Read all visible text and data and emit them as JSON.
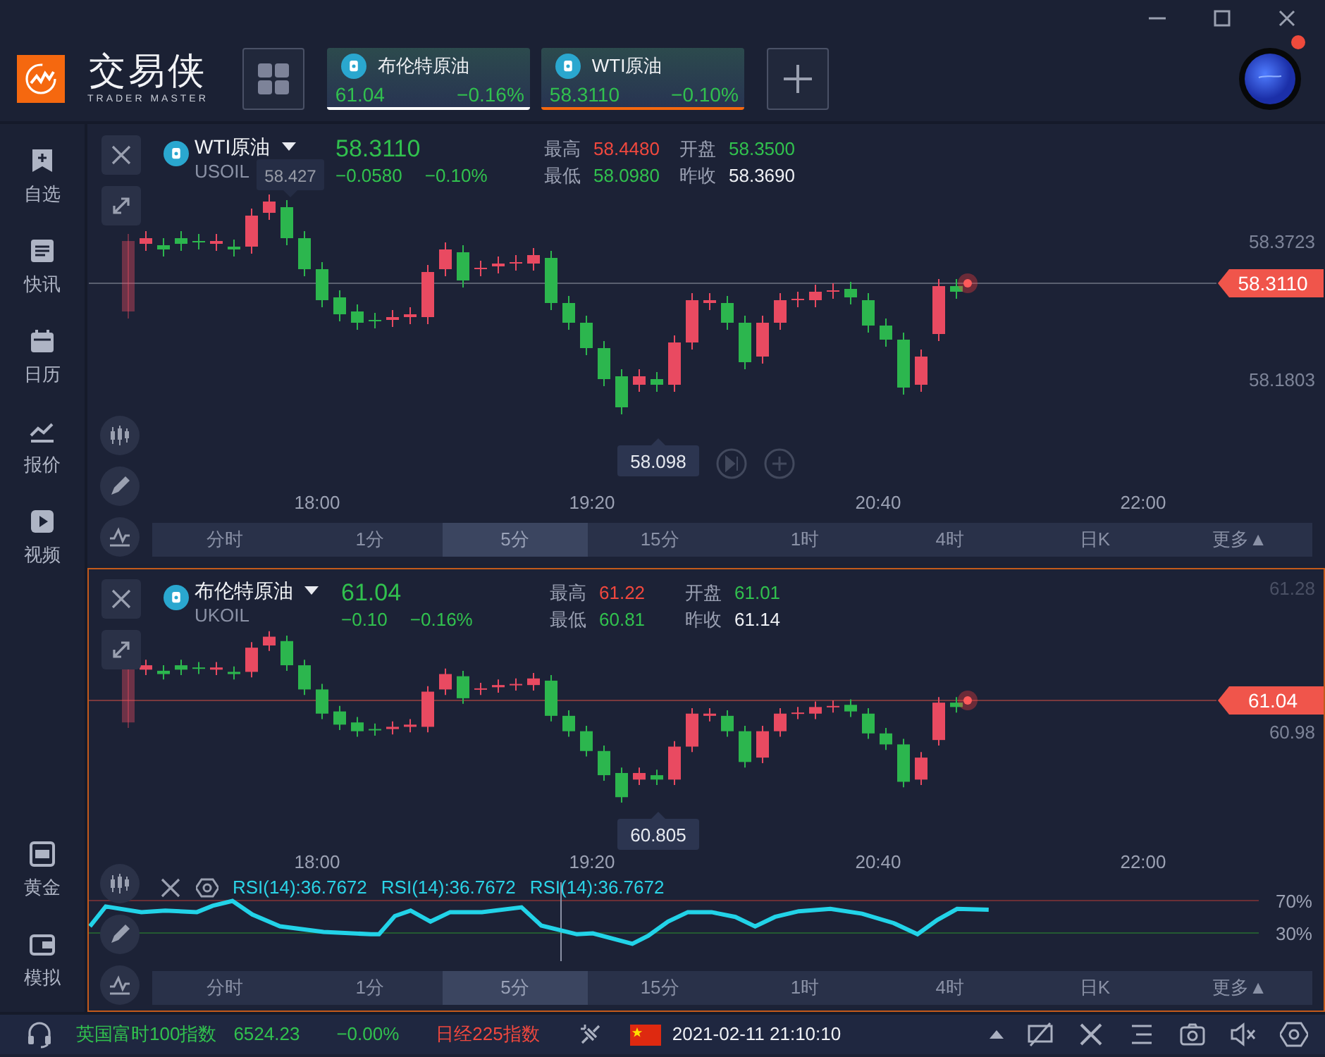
{
  "app": {
    "title": "交易侠",
    "subtitle": "TRADER MASTER"
  },
  "quote_tabs": [
    {
      "name": "布伦特原油",
      "price": "61.04",
      "change": "−0.16%",
      "selected": false
    },
    {
      "name": "WTI原油",
      "price": "58.3110",
      "change": "−0.10%",
      "selected": true
    }
  ],
  "sidebar": [
    {
      "label": "自选"
    },
    {
      "label": "快讯"
    },
    {
      "label": "日历"
    },
    {
      "label": "报价"
    },
    {
      "label": "视频"
    },
    {
      "label": "黄金"
    },
    {
      "label": "模拟"
    }
  ],
  "charts": [
    {
      "active": false,
      "symbol": "WTI原油",
      "code": "USOIL",
      "price": "58.3110",
      "change": "−0.0580",
      "change_pct": "−0.10%",
      "color": "#31c14e",
      "stats": [
        {
          "label": "最高",
          "value": "58.4480",
          "color": "#f0483e"
        },
        {
          "label": "开盘",
          "value": "58.3500",
          "color": "#31c14e"
        },
        {
          "label": "最低",
          "value": "58.0980",
          "color": "#31c14e"
        },
        {
          "label": "昨收",
          "value": "58.3690",
          "color": "#eef0f4"
        }
      ],
      "price_axis": [
        "58.3723",
        "58.1803"
      ],
      "current_price_tag": "58.3110",
      "high_label": "58.427",
      "low_label": "58.098",
      "time_axis": [
        "18:00",
        "19:20",
        "20:40",
        "22:00"
      ],
      "timeframes": [
        {
          "label": "分时",
          "selected": false
        },
        {
          "label": "1分",
          "selected": false
        },
        {
          "label": "5分",
          "selected": true
        },
        {
          "label": "15分",
          "selected": false
        },
        {
          "label": "1时",
          "selected": false
        },
        {
          "label": "4时",
          "selected": false
        },
        {
          "label": "日K",
          "selected": false
        },
        {
          "label": "更多▲",
          "selected": false
        }
      ]
    },
    {
      "active": true,
      "symbol": "布伦特原油",
      "code": "UKOIL",
      "price": "61.04",
      "change": "−0.10",
      "change_pct": "−0.16%",
      "color": "#31c14e",
      "stats": [
        {
          "label": "最高",
          "value": "61.22",
          "color": "#f0483e"
        },
        {
          "label": "开盘",
          "value": "61.01",
          "color": "#31c14e"
        },
        {
          "label": "最低",
          "value": "60.81",
          "color": "#31c14e"
        },
        {
          "label": "昨收",
          "value": "61.14",
          "color": "#eef0f4"
        }
      ],
      "price_axis": [
        "61.28",
        "60.98"
      ],
      "current_price_tag": "61.04",
      "low_label": "60.805",
      "time_axis": [
        "18:00",
        "19:20",
        "20:40",
        "22:00"
      ],
      "indicator": {
        "labels": [
          "RSI(14):36.7672",
          "RSI(14):36.7672",
          "RSI(14):36.7672"
        ],
        "levels": [
          "70%",
          "30%"
        ]
      },
      "timeframes": [
        {
          "label": "分时",
          "selected": false
        },
        {
          "label": "1分",
          "selected": false
        },
        {
          "label": "5分",
          "selected": true
        },
        {
          "label": "15分",
          "selected": false
        },
        {
          "label": "1时",
          "selected": false
        },
        {
          "label": "4时",
          "selected": false
        },
        {
          "label": "日K",
          "selected": false
        },
        {
          "label": "更多▲",
          "selected": false
        }
      ]
    }
  ],
  "status_bar": {
    "tickers": [
      {
        "text": "英国富时100指数",
        "color": "#31c14e"
      },
      {
        "text": "6524.23",
        "color": "#31c14e"
      },
      {
        "text": "−0.00%",
        "color": "#31c14e"
      },
      {
        "text": "日经225指数",
        "color": "#f0483e"
      }
    ],
    "datetime": "2021-02-11 21:10:10"
  }
}
